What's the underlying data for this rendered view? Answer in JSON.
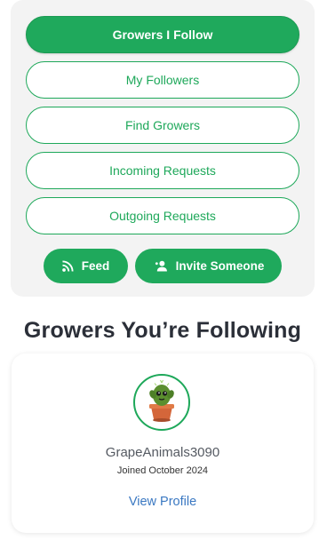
{
  "nav": {
    "items": [
      {
        "label": "Growers I Follow",
        "active": true
      },
      {
        "label": "My Followers",
        "active": false
      },
      {
        "label": "Find Growers",
        "active": false
      },
      {
        "label": "Incoming Requests",
        "active": false
      },
      {
        "label": "Outgoing Requests",
        "active": false
      }
    ],
    "feed_label": "Feed",
    "invite_label": "Invite Someone"
  },
  "section": {
    "title": "Growers You’re Following"
  },
  "grower": {
    "username": "GrapeAnimals3090",
    "joined": "Joined October 2024",
    "view_profile_label": "View Profile"
  },
  "colors": {
    "accent": "#1fa95c",
    "link": "#3a78c2",
    "card_bg": "#f3f3f3"
  },
  "icons": {
    "feed": "rss-icon",
    "invite": "add-user-icon",
    "avatar": "cactus-plant-avatar"
  }
}
